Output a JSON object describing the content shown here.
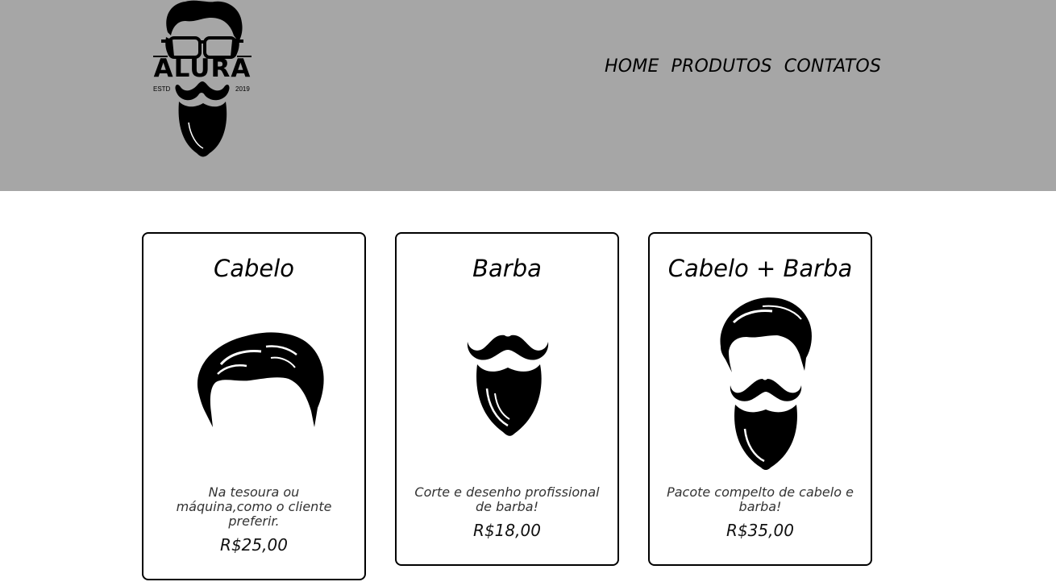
{
  "header": {
    "logo": {
      "text": "ALURA",
      "estd": "ESTD",
      "year": "2019",
      "icon": "bearded-man-logo-icon"
    },
    "nav": [
      {
        "label": "HOME"
      },
      {
        "label": "PRODUTOS"
      },
      {
        "label": "CONTATOS"
      }
    ]
  },
  "products": [
    {
      "title": "Cabelo",
      "icon": "hair-icon",
      "description": "Na tesoura ou máquina,como o cliente preferir.",
      "price": "R$25,00"
    },
    {
      "title": "Barba",
      "icon": "beard-icon",
      "description": "Corte e desenho profissional de barba!",
      "price": "R$18,00"
    },
    {
      "title": "Cabelo + Barba",
      "icon": "hair-and-beard-icon",
      "description": "Pacote compelto de cabelo e barba!",
      "price": "R$35,00"
    }
  ],
  "colors": {
    "header_bg": "#a6a6a6",
    "page_bg": "#ffffff",
    "text": "#000000"
  }
}
